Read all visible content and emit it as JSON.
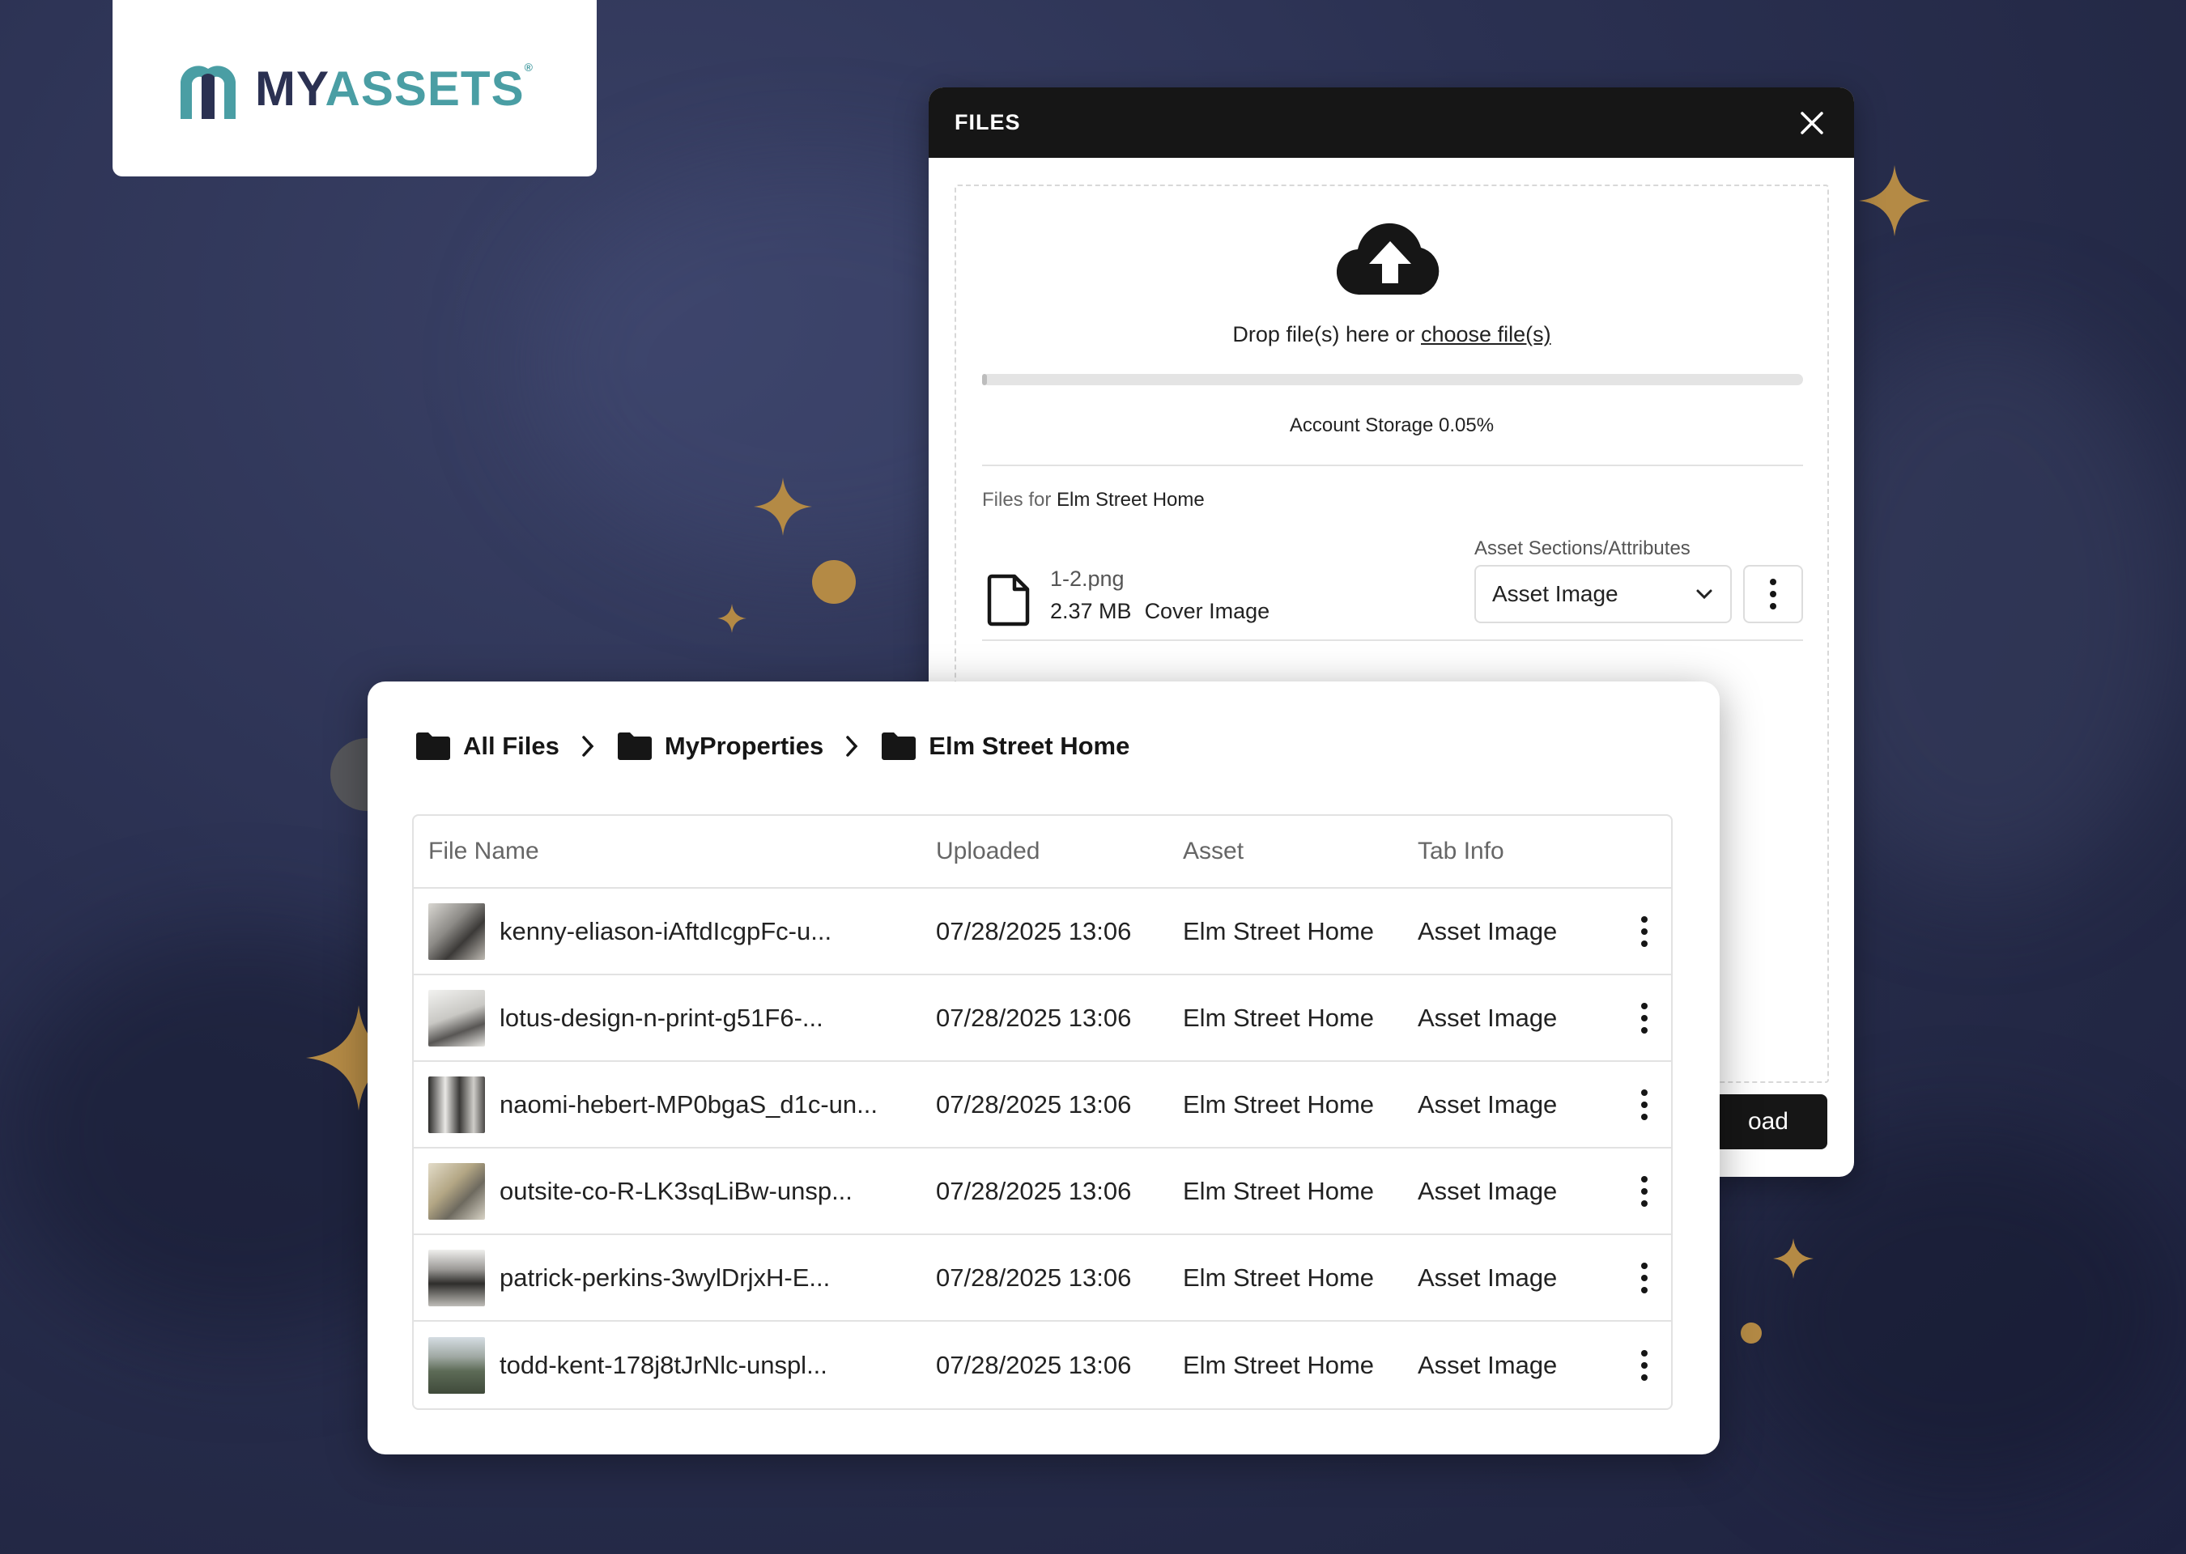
{
  "logo": {
    "my": "MY",
    "assets": "ASSETS",
    "reg": "®"
  },
  "files_dialog": {
    "title": "FILES",
    "drop_text": "Drop file(s) here or ",
    "choose_link": "choose file(s)",
    "storage_text": "Account Storage 0.05%",
    "storage_percent": 0.05,
    "files_for_prefix": "Files for ",
    "files_for_asset": "Elm Street Home",
    "sections_label": "Asset Sections/Attributes",
    "file": {
      "name": "1-2.png",
      "size": "2.37 MB",
      "type": "Cover Image"
    },
    "select_value": "Asset Image",
    "upload_label": "oad"
  },
  "breadcrumb": [
    {
      "label": "All Files"
    },
    {
      "label": "MyProperties"
    },
    {
      "label": "Elm Street Home"
    }
  ],
  "table": {
    "headers": {
      "file_name": "File Name",
      "uploaded": "Uploaded",
      "asset": "Asset",
      "tab_info": "Tab Info"
    },
    "rows": [
      {
        "name": "kenny-eliason-iAftdIcgpFc-u...",
        "uploaded": "07/28/2025 13:06",
        "asset": "Elm Street Home",
        "tab": "Asset Image"
      },
      {
        "name": "lotus-design-n-print-g51F6-...",
        "uploaded": "07/28/2025 13:06",
        "asset": "Elm Street Home",
        "tab": "Asset Image"
      },
      {
        "name": "naomi-hebert-MP0bgaS_d1c-un...",
        "uploaded": "07/28/2025 13:06",
        "asset": "Elm Street Home",
        "tab": "Asset Image"
      },
      {
        "name": "outsite-co-R-LK3sqLiBw-unsp...",
        "uploaded": "07/28/2025 13:06",
        "asset": "Elm Street Home",
        "tab": "Asset Image"
      },
      {
        "name": "patrick-perkins-3wylDrjxH-E...",
        "uploaded": "07/28/2025 13:06",
        "asset": "Elm Street Home",
        "tab": "Asset Image"
      },
      {
        "name": "todd-kent-178j8tJrNlc-unspl...",
        "uploaded": "07/28/2025 13:06",
        "asset": "Elm Street Home",
        "tab": "Asset Image"
      }
    ]
  },
  "colors": {
    "accent": "#4a9ea4",
    "brand_dark": "#2b3152",
    "gold": "#b48a45",
    "background": "#262b4a"
  }
}
